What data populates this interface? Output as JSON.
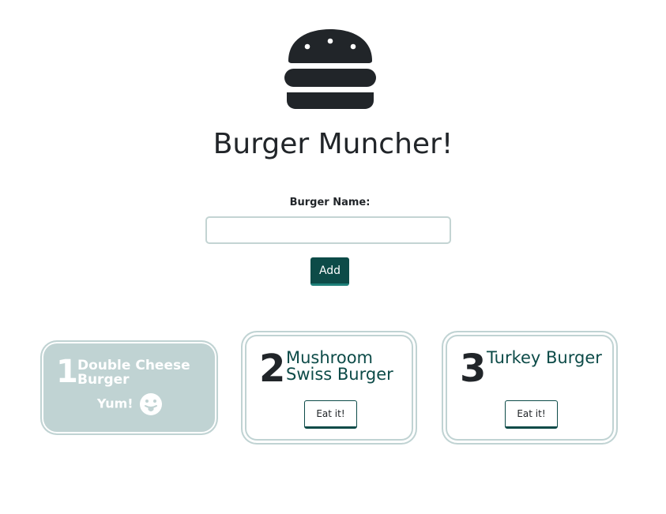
{
  "header": {
    "logo_icon": "burger-icon",
    "title": "Burger Muncher!"
  },
  "form": {
    "label": "Burger Name:",
    "input_value": "",
    "add_label": "Add"
  },
  "burgers": [
    {
      "number": "1",
      "name": "Double Cheese Burger",
      "devoured": true,
      "status_text": "Yum!",
      "status_icon": "tongue-smiley-icon"
    },
    {
      "number": "2",
      "name": "Mushroom Swiss Burger",
      "devoured": false,
      "button_label": "Eat it!"
    },
    {
      "number": "3",
      "name": "Turkey Burger",
      "devoured": false,
      "button_label": "Eat it!"
    }
  ],
  "colors": {
    "accent": "#0d4b48",
    "card_border": "#c0d3d3",
    "eaten_bg": "#c0d3d3",
    "text_dark": "#212529"
  }
}
